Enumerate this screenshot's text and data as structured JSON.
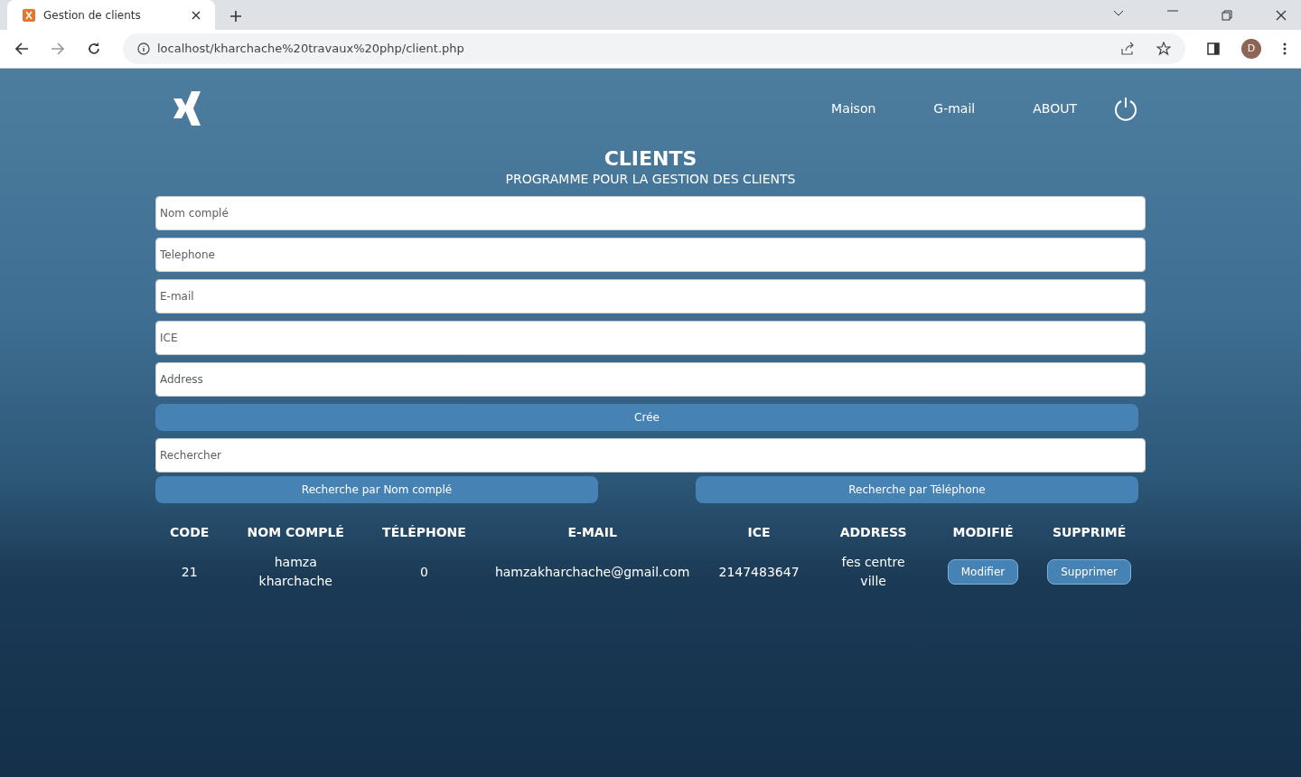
{
  "browser": {
    "tab_title": "Gestion de clients",
    "url": "localhost/kharchache%20travaux%20php/client.php",
    "avatar_letter": "D"
  },
  "nav": {
    "items": [
      "Maison",
      "G-mail",
      "ABOUT"
    ]
  },
  "header": {
    "title": "CLIENTS",
    "subtitle": "PROGRAMME POUR LA GESTION DES CLIENTS"
  },
  "form": {
    "fields": [
      {
        "placeholder": "Nom complé"
      },
      {
        "placeholder": "Telephone"
      },
      {
        "placeholder": "E-mail"
      },
      {
        "placeholder": "ICE"
      },
      {
        "placeholder": "Address"
      }
    ],
    "create_button": "Crée"
  },
  "search": {
    "placeholder": "Rechercher",
    "buttons": [
      "Recherche par Nom complé",
      "Recherche par Téléphone"
    ]
  },
  "table": {
    "columns": [
      "CODE",
      "NOM COMPLÉ",
      "TÉLÉPHONE",
      "E-MAIL",
      "ICE",
      "ADDRESS",
      "MODIFIÉ",
      "SUPPRIMÉ"
    ],
    "rows": [
      {
        "cells": [
          "21",
          "hamza kharchache",
          "0",
          "hamzakharchache@gmail.com",
          "2147483647",
          "fes centre ville"
        ],
        "actions": [
          "Modifier",
          "Supprimer"
        ]
      }
    ]
  }
}
